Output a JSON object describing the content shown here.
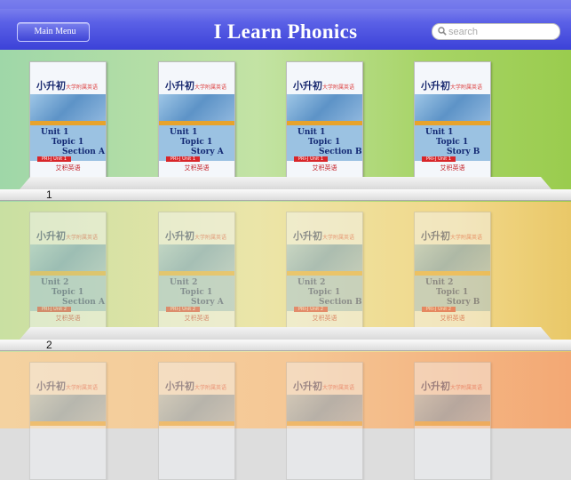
{
  "header": {
    "title": "I Learn Phonics",
    "back_label": "Main Menu",
    "search_placeholder": "search"
  },
  "shelves": [
    {
      "number": "1"
    },
    {
      "number": "2"
    }
  ],
  "books": {
    "brand": "小升初",
    "brand_sub": "大学附属英语",
    "publisher": "艾积英语",
    "row1": [
      {
        "l1": "Unit 1",
        "l2": "Topic 1",
        "l3": "Section A",
        "tag": "PRI-J Unit 1"
      },
      {
        "l1": "Unit 1",
        "l2": "Topic 1",
        "l3": "Story A",
        "tag": "PRI-J Unit 1"
      },
      {
        "l1": "Unit 1",
        "l2": "Topic 1",
        "l3": "Section B",
        "tag": "PRI-J Unit 1"
      },
      {
        "l1": "Unit 1",
        "l2": "Topic 1",
        "l3": "Story B",
        "tag": "PRI-J Unit 1"
      }
    ],
    "row2": [
      {
        "l1": "Unit 2",
        "l2": "Topic 1",
        "l3": "Section A",
        "tag": "PRI-J Unit 2"
      },
      {
        "l1": "Unit 2",
        "l2": "Topic 1",
        "l3": "Story A",
        "tag": "PRI-J Unit 2"
      },
      {
        "l1": "Unit 2",
        "l2": "Topic 1",
        "l3": "Section B",
        "tag": "PRI-J Unit 2"
      },
      {
        "l1": "Unit 2",
        "l2": "Topic 1",
        "l3": "Story B",
        "tag": "PRI-J Unit 2"
      }
    ]
  }
}
